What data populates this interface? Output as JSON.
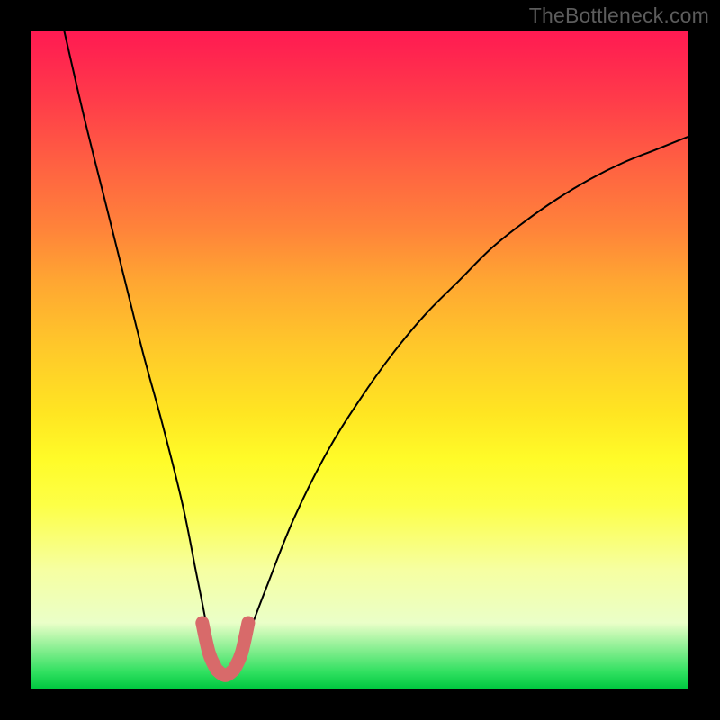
{
  "watermark": "TheBottleneck.com",
  "chart_data": {
    "type": "line",
    "title": "",
    "xlabel": "",
    "ylabel": "",
    "xlim": [
      0,
      100
    ],
    "ylim": [
      0,
      100
    ],
    "grid": false,
    "legend": false,
    "series": [
      {
        "name": "bottleneck-curve",
        "x": [
          5,
          8,
          11,
          14,
          17,
          20,
          23,
          25,
          26,
          27,
          28,
          29,
          30,
          31,
          32,
          33,
          36,
          40,
          45,
          50,
          55,
          60,
          65,
          70,
          75,
          80,
          85,
          90,
          95,
          100
        ],
        "values": [
          100,
          87,
          75,
          63,
          51,
          40,
          28,
          18,
          13,
          8,
          4,
          2.5,
          2,
          2.5,
          4,
          8,
          16,
          26,
          36,
          44,
          51,
          57,
          62,
          67,
          71,
          74.5,
          77.5,
          80,
          82,
          84
        ]
      },
      {
        "name": "optimal-marker",
        "x": [
          26,
          27,
          28,
          28.5,
          29,
          29.5,
          30,
          30.5,
          31,
          32,
          33
        ],
        "values": [
          10,
          5.5,
          3.2,
          2.6,
          2.2,
          2.0,
          2.2,
          2.6,
          3.2,
          5.5,
          10
        ]
      }
    ],
    "background_gradient": {
      "top": "#ff1a52",
      "mid": "#ffe522",
      "bottom": "#00c840"
    }
  }
}
